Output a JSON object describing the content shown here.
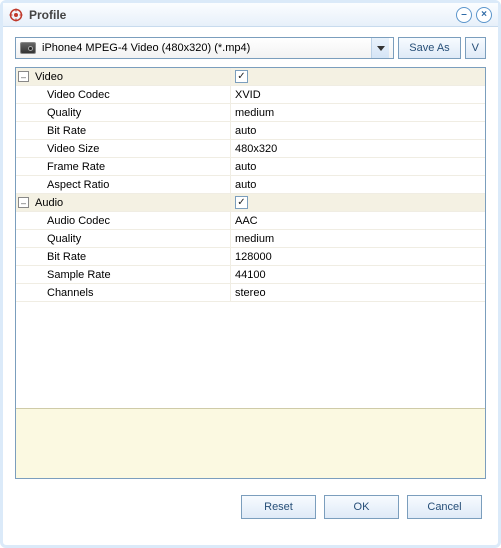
{
  "window": {
    "title": "Profile"
  },
  "toolbar": {
    "profile_selected": "iPhone4 MPEG-4 Video (480x320) (*.mp4)",
    "save_as_label": "Save As",
    "v_label": "V"
  },
  "groups": {
    "video": {
      "label": "Video",
      "enabled": true,
      "rows": [
        {
          "key": "Video Codec",
          "value": "XVID"
        },
        {
          "key": "Quality",
          "value": "medium"
        },
        {
          "key": "Bit Rate",
          "value": "auto"
        },
        {
          "key": "Video Size",
          "value": "480x320"
        },
        {
          "key": "Frame Rate",
          "value": "auto"
        },
        {
          "key": "Aspect Ratio",
          "value": "auto"
        }
      ]
    },
    "audio": {
      "label": "Audio",
      "enabled": true,
      "rows": [
        {
          "key": "Audio Codec",
          "value": "AAC"
        },
        {
          "key": "Quality",
          "value": "medium"
        },
        {
          "key": "Bit Rate",
          "value": "128000"
        },
        {
          "key": "Sample Rate",
          "value": "44100"
        },
        {
          "key": "Channels",
          "value": "stereo"
        }
      ]
    }
  },
  "footer": {
    "reset_label": "Reset",
    "ok_label": "OK",
    "cancel_label": "Cancel"
  }
}
